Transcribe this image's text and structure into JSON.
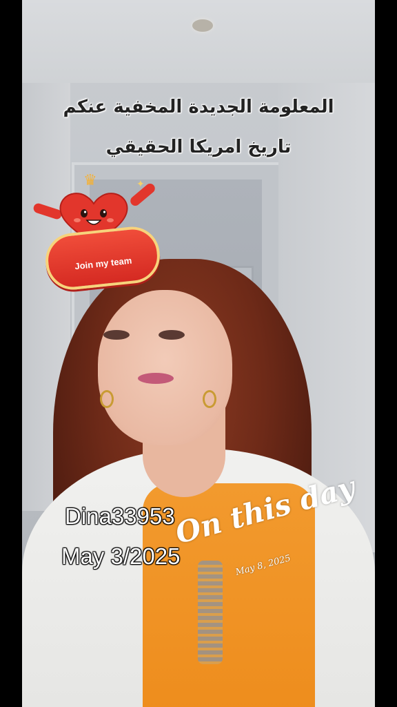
{
  "caption": {
    "line1": "المعلومة الجديدة المخفية عنكم",
    "line2": "تاريخ امريكا الحقيقي"
  },
  "sticker": {
    "button_label": "Join my team",
    "icons": [
      "heart-mascot-icon",
      "crown-icon",
      "sparkle-icon"
    ],
    "colors": {
      "heart": "#e2362c",
      "pill": "#d52a22",
      "pill_border": "#f7d37c"
    }
  },
  "watermark": {
    "username": "Dina33953",
    "date": "May 3/2025"
  },
  "memory": {
    "title": "On this day",
    "date": "May 8, 2025"
  }
}
